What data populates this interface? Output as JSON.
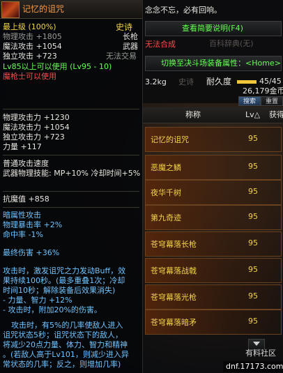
{
  "tooltip": {
    "item_name": "记忆的诅咒",
    "grade": "史诗",
    "weapon_type": "长枪",
    "category": "武器",
    "trade": "无法交易",
    "min_level_line": "最上级 (100%)",
    "base_stats": [
      {
        "label": "物理攻击 +1805",
        "cls": "g"
      },
      {
        "label": "魔法攻击 +1054",
        "cls": "w"
      },
      {
        "label": "独立攻击 +723",
        "cls": "w"
      }
    ],
    "level_req": "Lv85以上可以使用 (Lv95 - 10)",
    "class_req": "魔枪士可以使用",
    "attack_lines": [
      "物理攻击力 +1230",
      "魔法攻击力 +1054",
      "独立攻击力 +723",
      "力量 +117"
    ],
    "normal_attack_speed": "普通攻击速度",
    "weapon_skill": "武器物理技能: MP+10% 冷却时间+5%",
    "anti_demon": "抗魔值 +858",
    "dark_attack": "暗属性攻击",
    "phys_crit": "物理暴击率 +2%",
    "hit_rate": "命中率 -1%",
    "final_damage": "最终伤害 +36%",
    "effect_lines_1": [
      "攻击时，激发诅咒之力发动Buff，效",
      "果持续100秒。(最多重叠1次；冷却",
      "时间10秒；解除装备后效果消失)",
      "- 力量、智力 +12%",
      "- 攻击时，附加20%的伤害。"
    ],
    "effect_lines_2": [
      "攻击时，有5%的几率使敌人进入",
      "诅咒状态5秒；诅咒状态下的敌人，",
      "将减少20点力量、体力、智力和精神",
      "。(若敌人高于Lv101，则减少进入异",
      "常状态的几率；反之，则增加几率)"
    ]
  },
  "panel": {
    "tip_text": "念念不忘，必有回响。",
    "view_desc_button": "查看简要说明(F4)",
    "cannot_combine": "无法合成",
    "baike_faded": "百科辞典(无)",
    "switch_attr_button": "切换至决斗场装备属性：<Home>",
    "weight": "3.2kg",
    "grade_faded": "史诗",
    "durability_label": "耐久度",
    "durability_value": "45/45",
    "price": "26,179金币",
    "search_button": "搜索",
    "sort_button": "重置",
    "col_name": "称称",
    "col_level": "Lv△",
    "col_obtain": "获得",
    "items": [
      {
        "name": "记忆的诅咒",
        "level": "95"
      },
      {
        "name": "恶魔之鳞",
        "level": "95"
      },
      {
        "name": "夜华千树",
        "level": "95"
      },
      {
        "name": "第九奇迹",
        "level": "95"
      },
      {
        "name": "苍穹幕落长枪",
        "level": "95"
      },
      {
        "name": "苍穹幕落战戟",
        "level": "95"
      },
      {
        "name": "苍穹幕落光枪",
        "level": "95"
      },
      {
        "name": "苍穹幕落暗矛",
        "level": "95"
      }
    ]
  },
  "watermark": {
    "site": "有料社区",
    "url": "dnf.17173.com"
  }
}
